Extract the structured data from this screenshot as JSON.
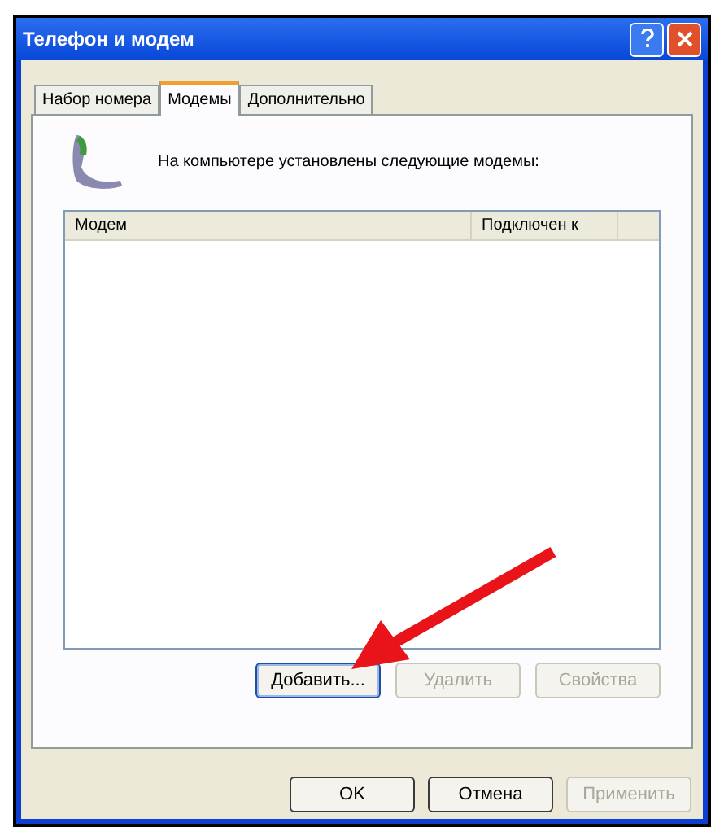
{
  "window": {
    "title": "Телефон и модем"
  },
  "tabs": [
    {
      "label": "Набор номера",
      "selected": false
    },
    {
      "label": "Модемы",
      "selected": true
    },
    {
      "label": "Дополнительно",
      "selected": false
    }
  ],
  "intro": "На компьютере установлены следующие модемы:",
  "table": {
    "columns": [
      "Модем",
      "Подключен к"
    ]
  },
  "list_buttons": [
    {
      "label": "Добавить...",
      "disabled": false
    },
    {
      "label": "Удалить",
      "disabled": true
    },
    {
      "label": "Свойства",
      "disabled": true
    }
  ],
  "dialog_buttons": [
    {
      "label": "OK",
      "disabled": false
    },
    {
      "label": "Отмена",
      "disabled": false
    },
    {
      "label": "Применить",
      "disabled": true
    }
  ]
}
